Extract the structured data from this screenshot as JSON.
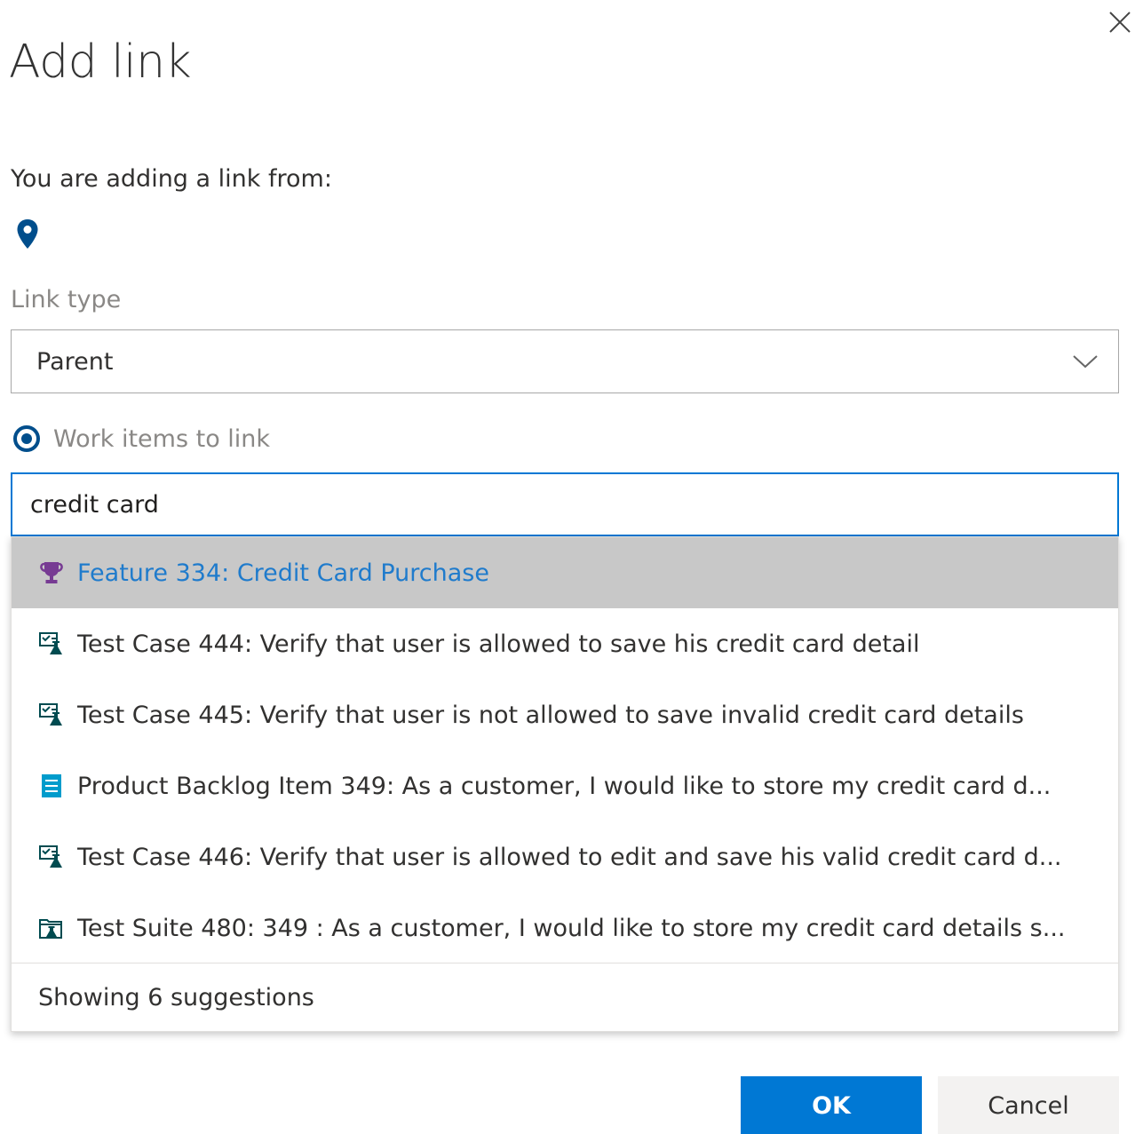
{
  "dialog": {
    "title": "Add link",
    "close_icon": "close-icon"
  },
  "source": {
    "label": "You are adding a link from:",
    "icon": "map-pin-icon",
    "icon_color": "#004e8c"
  },
  "link_type": {
    "label": "Link type",
    "value": "Parent"
  },
  "work_items": {
    "label": "Work items to link",
    "search_value": "credit card",
    "suggestions": [
      {
        "icon": "trophy-icon",
        "text": "Feature 334: Credit Card Purchase",
        "active": true
      },
      {
        "icon": "test-case-icon",
        "text": "Test Case 444: Verify that user is allowed to save his credit card detail"
      },
      {
        "icon": "test-case-icon",
        "text": "Test Case 445: Verify that user is not allowed to save invalid credit card details"
      },
      {
        "icon": "backlog-item-icon",
        "text": "Product Backlog Item 349:  As a customer, I would like to store my credit card d..."
      },
      {
        "icon": "test-case-icon",
        "text": "Test Case 446:  Verify that user is allowed to edit and save his valid credit card d..."
      },
      {
        "icon": "test-suite-icon",
        "text": "Test Suite 480:  349 : As a customer, I would like to store my credit card details s..."
      }
    ],
    "footer": "Showing 6 suggestions"
  },
  "actions": {
    "ok_label": "OK",
    "cancel_label": "Cancel"
  },
  "colors": {
    "accent": "#0078d4",
    "feature": "#773b93",
    "test": "#004b50",
    "backlog": "#009ccc",
    "active_text": "#1f7bcc"
  }
}
